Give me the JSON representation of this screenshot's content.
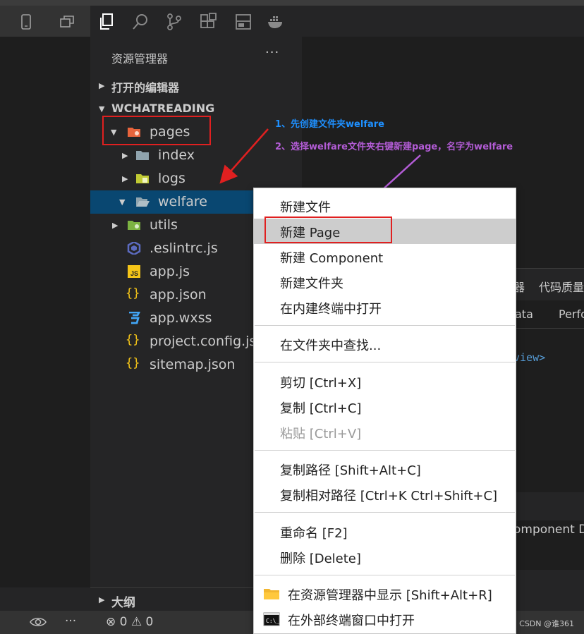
{
  "explorer": {
    "title": "资源管理器",
    "more": "···",
    "open_editors": "打开的编辑器",
    "project": "WCHATREADING"
  },
  "tree": [
    {
      "name": "pages",
      "expanded": true
    },
    {
      "name": "index"
    },
    {
      "name": "logs"
    },
    {
      "name": "welfare",
      "selected": true
    },
    {
      "name": "utils"
    },
    {
      "name": ".eslintrc.js"
    },
    {
      "name": "app.js"
    },
    {
      "name": "app.json"
    },
    {
      "name": "app.wxss"
    },
    {
      "name": "project.config.json"
    },
    {
      "name": "sitemap.json"
    }
  ],
  "outline": "大纲",
  "statusbar": {
    "errors": "0",
    "warnings": "0",
    "credit": "CSDN @谁361"
  },
  "editor": {
    "panel_tab_partial": "器",
    "panel_tab_quality": "代码质量",
    "sub_tab_data": "ata",
    "sub_tab_perf": "Perfo",
    "code_fragment": "view>",
    "component_fragment": "omponent D"
  },
  "annotations": {
    "step1": "1、先创建文件夹welfare",
    "step2": "2、选择welfare文件夹右键新建page，名字为welfare"
  },
  "context_menu": {
    "new_file": "新建文件",
    "new_page": "新建 Page",
    "new_component": "新建 Component",
    "new_folder": "新建文件夹",
    "open_in_terminal": "在内建终端中打开",
    "find_in_folder": "在文件夹中查找...",
    "cut": "剪切  [Ctrl+X]",
    "copy": "复制  [Ctrl+C]",
    "paste": "粘贴  [Ctrl+V]",
    "copy_path": "复制路径  [Shift+Alt+C]",
    "copy_relative_path": "复制相对路径  [Ctrl+K Ctrl+Shift+C]",
    "rename": "重命名  [F2]",
    "delete": "删除  [Delete]",
    "reveal": "在资源管理器中显示  [Shift+Alt+R]",
    "external_terminal": "在外部终端窗口中打开"
  }
}
